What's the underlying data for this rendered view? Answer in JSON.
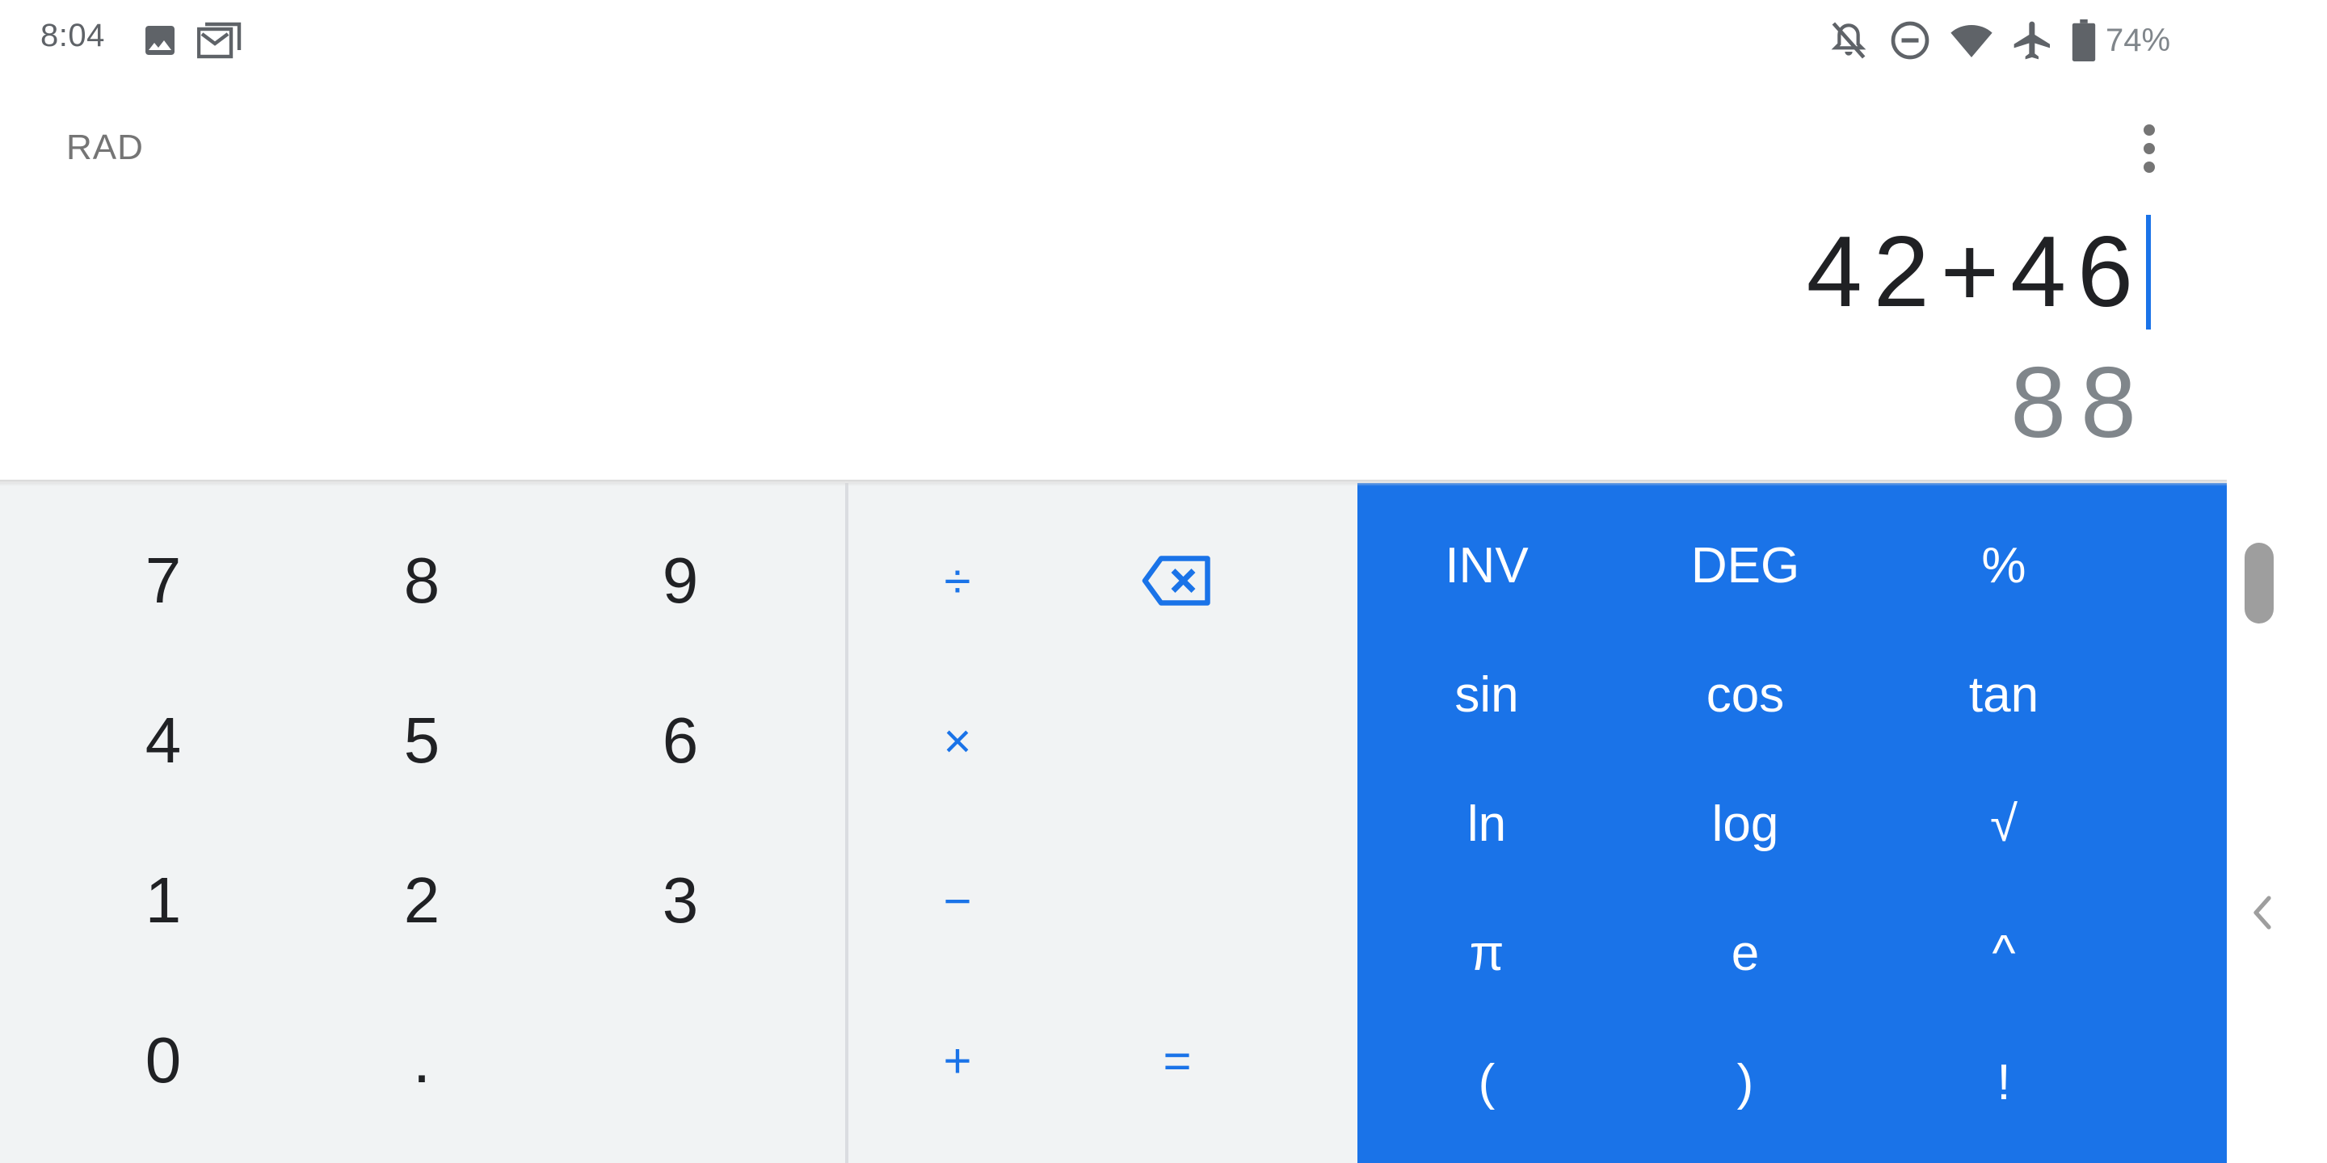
{
  "status_bar": {
    "time": "8:04",
    "notification_icons": [
      "image-icon",
      "gmail-icon"
    ],
    "system_icons": [
      "notifications-off-icon",
      "do-not-disturb-icon",
      "wifi-icon",
      "airplane-icon",
      "battery-icon"
    ],
    "battery_percent": "74%"
  },
  "display": {
    "angle_mode": "RAD",
    "formula": "42+46",
    "result": "88"
  },
  "keypad": {
    "numeric": [
      "7",
      "8",
      "9",
      "4",
      "5",
      "6",
      "1",
      "2",
      "3",
      "0",
      "."
    ],
    "operators": {
      "divide": "÷",
      "multiply": "×",
      "minus": "−",
      "plus": "+",
      "equals": "="
    },
    "advanced": [
      "INV",
      "DEG",
      "%",
      "sin",
      "cos",
      "tan",
      "ln",
      "log",
      "√",
      "π",
      "e",
      "^",
      "(",
      ")",
      "!"
    ]
  },
  "colors": {
    "accent": "#1a73e8",
    "pad_background": "#f1f3f4",
    "text_primary": "#202124",
    "text_secondary": "#80868b"
  }
}
